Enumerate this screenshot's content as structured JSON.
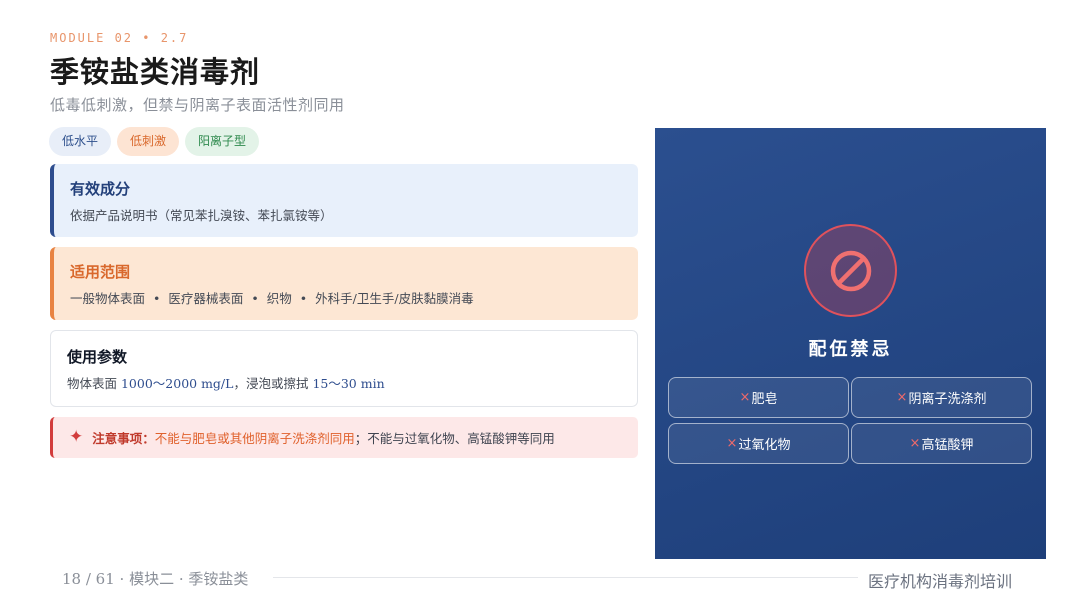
{
  "header": {
    "module_label": "MODULE 02  •  2.7",
    "title": "季铵盐类消毒剂",
    "subtitle": "低毒低刺激，但禁与阴离子表面活性剂同用"
  },
  "tags": [
    {
      "label": "低水平"
    },
    {
      "label": "低刺激"
    },
    {
      "label": "阳离子型"
    }
  ],
  "cards": {
    "effect": {
      "title": "有效成分",
      "body": "依据产品说明书（常见苯扎溴铵、苯扎氯铵等）"
    },
    "scope": {
      "title": "适用范围",
      "items": [
        "一般物体表面",
        "医疗器械表面",
        "织物",
        "外科手/卫生手/皮肤黏膜消毒"
      ],
      "separator": "•"
    },
    "params": {
      "title": "使用参数",
      "prefix": "物体表面 ",
      "concentration": "1000～2000 mg/L",
      "middle": "，浸泡或擦拭 ",
      "duration": "15～30 min"
    }
  },
  "notice": {
    "icon": "✦",
    "label": "注意事项：",
    "highlight": "不能与肥皂或其他阴离子洗涤剂同用",
    "rest": "；不能与过氧化物、高锰酸钾等同用"
  },
  "incompatibility_panel": {
    "icon": "ban-icon",
    "title": "配伍禁忌",
    "items": [
      {
        "mark": "×",
        "label": "肥皂"
      },
      {
        "mark": "×",
        "label": "阴离子洗涤剂"
      },
      {
        "mark": "×",
        "label": "过氧化物"
      },
      {
        "mark": "×",
        "label": "高锰酸钾"
      }
    ]
  },
  "footer": {
    "page": "18 / 61 · 模块二 · 季铵盐类",
    "course": "医疗机构消毒剂培训"
  },
  "colors": {
    "accent_navy": "#2e4d8e",
    "accent_orange": "#e88342",
    "warning_red": "#d23c3c",
    "panel_bg": "#24478a"
  }
}
